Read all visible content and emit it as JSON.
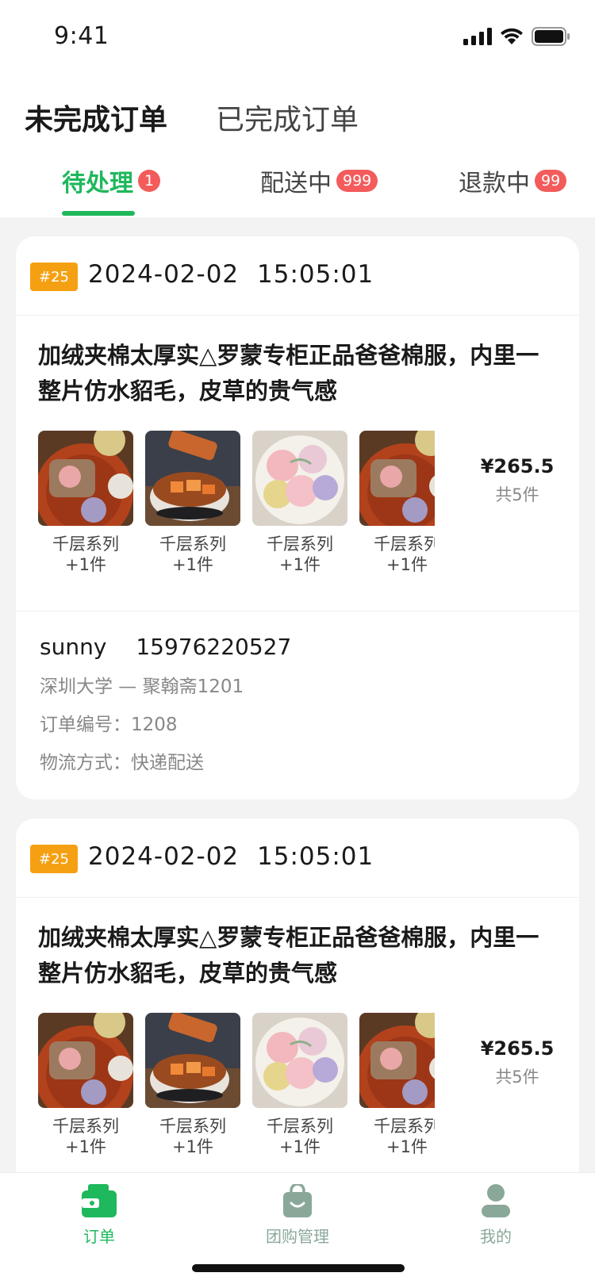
{
  "status_bar": {
    "time": "9:41"
  },
  "header": {
    "main_tabs": [
      {
        "label": "未完成订单",
        "active": true
      },
      {
        "label": "已完成订单",
        "active": false
      }
    ],
    "sub_tabs": [
      {
        "label": "待处理",
        "badge": "1",
        "active": true
      },
      {
        "label": "配送中",
        "badge": "999",
        "active": false
      },
      {
        "label": "退款中",
        "badge": "99",
        "active": false
      }
    ]
  },
  "orders": [
    {
      "tag": "#25",
      "datetime": "2024-02-02  15:05:01",
      "title": "加绒夹棉太厚实△罗蒙专柜正品爸爸棉服，内里一整片仿水貂毛，皮草的贵气感",
      "products": [
        {
          "name": "千层系列",
          "count": "+1件"
        },
        {
          "name": "千层系列",
          "count": "+1件"
        },
        {
          "name": "千层系列",
          "count": "+1件"
        },
        {
          "name": "千层系列",
          "count": "+1件"
        }
      ],
      "price": "¥265.5",
      "quantity": "共5件",
      "customer_name": "sunny",
      "customer_phone": "15976220527",
      "address": "深圳大学 — 聚翰斋1201",
      "order_number": "订单编号：1208",
      "delivery_method": "物流方式：快递配送"
    },
    {
      "tag": "#25",
      "datetime": "2024-02-02  15:05:01",
      "title": "加绒夹棉太厚实△罗蒙专柜正品爸爸棉服，内里一整片仿水貂毛，皮草的贵气感",
      "products": [
        {
          "name": "千层系列",
          "count": "+1件"
        },
        {
          "name": "千层系列",
          "count": "+1件"
        },
        {
          "name": "千层系列",
          "count": "+1件"
        },
        {
          "name": "千层系列",
          "count": "+1件"
        }
      ],
      "price": "¥265.5",
      "quantity": "共5件"
    }
  ],
  "bottom_nav": [
    {
      "label": "订单",
      "icon": "wallet-icon",
      "active": true
    },
    {
      "label": "团购管理",
      "icon": "shopping-bag-icon",
      "active": false
    },
    {
      "label": "我的",
      "icon": "user-icon",
      "active": false
    }
  ],
  "colors": {
    "accent": "#1fb85c",
    "badge": "#f45b5b",
    "order_tag": "#f5a012"
  }
}
